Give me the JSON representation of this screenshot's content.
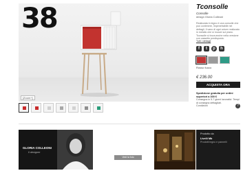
{
  "hero": {
    "number": "38",
    "zoom_label": "[Zoom+]"
  },
  "thumbnails": [
    {
      "color": "#c82a2a",
      "active": true
    },
    {
      "color": "#c82a2a",
      "active": false
    },
    {
      "color": "#d0d0d0",
      "active": false
    },
    {
      "color": "#a8a8a8",
      "active": false
    },
    {
      "color": "#d2d2d2",
      "active": false
    },
    {
      "color": "#8e8e8e",
      "active": false
    },
    {
      "color": "#2a9d7a",
      "active": false
    }
  ],
  "product": {
    "title": "Tconsolle",
    "category": "Consolle",
    "designer": "design Gloria Colleoni",
    "description": "Realizzata in legno è una consolle che può contenere, impenetrabile nei dettagli. Il vano di ogni colore realizzato in metallo che si muove sul piano. Tconsolle si trova anche nella versione con cassetto predisposto.",
    "link": "Tutti i dettagli",
    "social_icons": [
      "facebook-icon",
      "twitter-icon",
      "pinterest-icon",
      "houzz-icon"
    ],
    "swatches": [
      {
        "name": "red",
        "color": "#c03535",
        "selected": true
      },
      {
        "name": "grey",
        "color": "#9a9a9a",
        "selected": false
      },
      {
        "name": "teal",
        "color": "#2f9a86",
        "selected": false
      }
    ],
    "color_name": "Rosso fuoco",
    "price": "€ 236.00",
    "buy_label": "ACQUISTA ORA",
    "shipping_title": "Spedizione gratuita per ordini superiori a 300 €",
    "shipping_text": "Consegna in 5-7 giorni lavorativi. Tempi di consegna dettagliati.",
    "shipping_link": "Condizioni"
  },
  "bottom": {
    "designer_name": "GLORIA COLLEONI",
    "designer_role": "Il designer",
    "next_label": "Vedi la foto",
    "prod_title": "Prodotto da",
    "prod_name": "Livelli Mb",
    "prod_subtitle": "Prodotti legno e pannelli"
  },
  "colors": {
    "accent_red": "#c82a2a",
    "dark": "#1e1e1e"
  }
}
